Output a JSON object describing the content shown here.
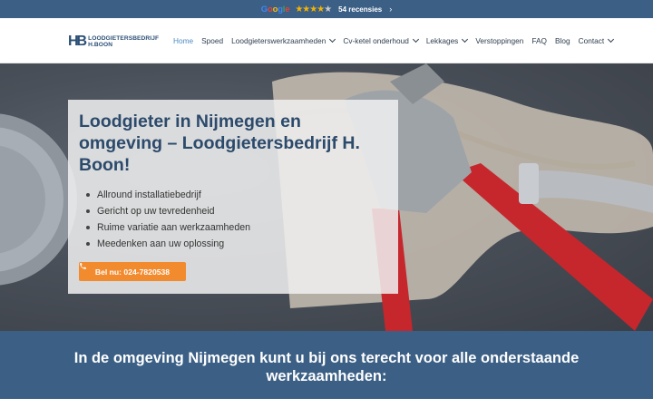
{
  "topbar": {
    "google_letters": [
      "G",
      "o",
      "o",
      "g",
      "l",
      "e"
    ],
    "google_colors": [
      "#4285F4",
      "#EA4335",
      "#FBBC05",
      "#4285F4",
      "#34A853",
      "#EA4335"
    ],
    "rating_stars": 4.5,
    "reviews_label": "54 recensies",
    "chevron": "›"
  },
  "logo": {
    "mark": "HB",
    "line1": "LOODGIETERSBEDRIJF",
    "line2": "H.BOON"
  },
  "nav": {
    "items": [
      {
        "label": "Home",
        "active": true,
        "has_dropdown": false
      },
      {
        "label": "Spoed",
        "active": false,
        "has_dropdown": false
      },
      {
        "label": "Loodgieterswerkzaamheden",
        "active": false,
        "has_dropdown": true
      },
      {
        "label": "Cv-ketel onderhoud",
        "active": false,
        "has_dropdown": true
      },
      {
        "label": "Lekkages",
        "active": false,
        "has_dropdown": true
      },
      {
        "label": "Verstoppingen",
        "active": false,
        "has_dropdown": false
      },
      {
        "label": "FAQ",
        "active": false,
        "has_dropdown": false
      },
      {
        "label": "Blog",
        "active": false,
        "has_dropdown": false
      },
      {
        "label": "Contact",
        "active": false,
        "has_dropdown": true
      }
    ]
  },
  "hero": {
    "title": "Loodgieter in Nijmegen en omgeving – Loodgietersbedrijf H. Boon!",
    "bullets": [
      "Allround installatiebedrijf",
      "Gericht op uw tevredenheid",
      "Ruime variatie aan werkzaamheden",
      "Meedenken aan uw oplossing"
    ],
    "cta_label": "Bel nu: 024-7820538",
    "cta_icon": "phone-icon"
  },
  "band": {
    "heading": "In de omgeving Nijmegen kunt u bij ons terecht voor alle onderstaande werkzaamheden:"
  },
  "colors": {
    "brand_blue": "#3b5f85",
    "cta_orange": "#f28a2e",
    "active_link": "#4d8bc4",
    "star_gold": "#f5b301"
  }
}
